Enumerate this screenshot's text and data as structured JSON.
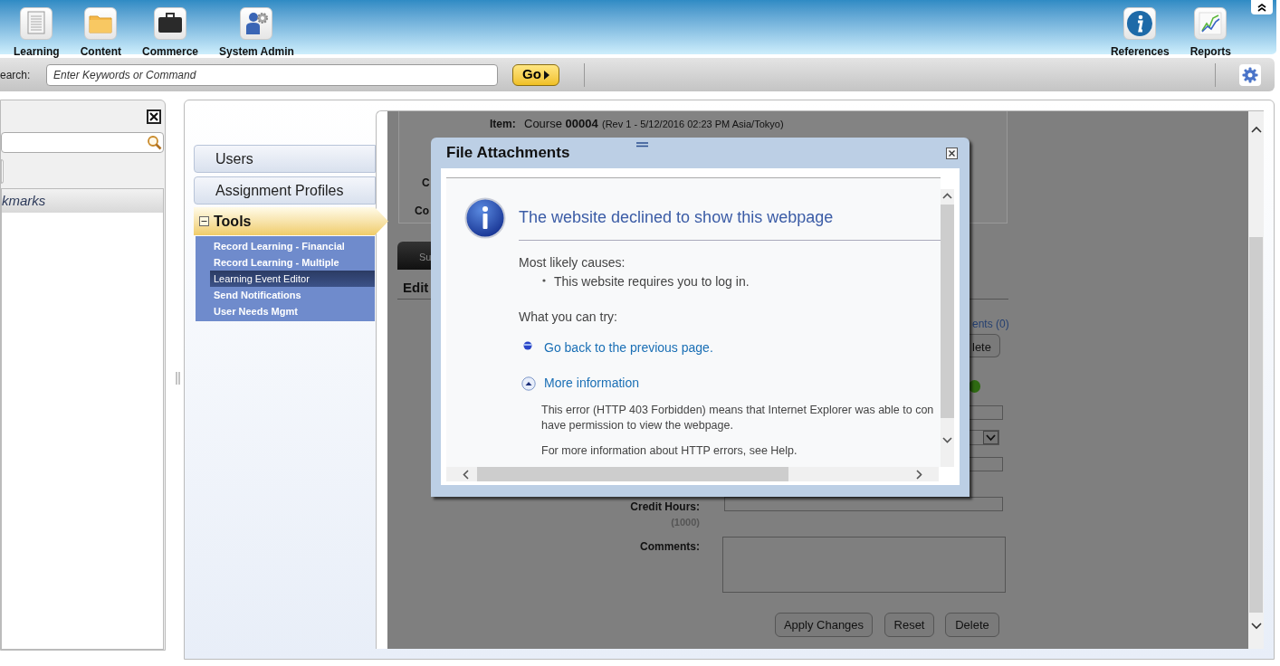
{
  "top_nav": {
    "left_items": [
      {
        "label": "Learning"
      },
      {
        "label": "Content"
      },
      {
        "label": "Commerce"
      },
      {
        "label": "System Admin"
      }
    ],
    "right_items": [
      {
        "label": "References"
      },
      {
        "label": "Reports"
      }
    ]
  },
  "search_bar": {
    "label": "earch:",
    "placeholder": "Enter Keywords or Command",
    "go_button": "Go"
  },
  "left_panel": {
    "bookmarks_header": "kmarks"
  },
  "nav": {
    "items": [
      {
        "label": "Users",
        "selected": false,
        "expanded": false
      },
      {
        "label": "Assignment Profiles",
        "selected": false,
        "expanded": false
      },
      {
        "label": "Tools",
        "selected": true,
        "expanded": true,
        "children": [
          {
            "label": "Record Learning - Financial",
            "selected": false
          },
          {
            "label": "Record Learning - Multiple",
            "selected": false
          },
          {
            "label": "Learning Event Editor",
            "selected": true
          },
          {
            "label": "Send Notifications",
            "selected": false
          },
          {
            "label": "User Needs Mgmt",
            "selected": false
          }
        ]
      }
    ]
  },
  "form": {
    "item_label": "Item:",
    "item_value": "Course **00004**",
    "item_revision": "(Rev 1 - 5/12/2016 02:23 PM Asia/Tokyo)",
    "partial_labels": [
      "C",
      "Co"
    ],
    "tab": "Su",
    "section_title": "Edit",
    "attachments_link": "ents (0)",
    "partial_button": "lete",
    "fields": [
      {
        "kind": "text",
        "label": "Credit Hours:",
        "hint": "(1000)"
      },
      {
        "kind": "textarea",
        "label": "Comments:"
      }
    ],
    "buttons": [
      "Apply Changes",
      "Reset",
      "Delete"
    ]
  },
  "dialog": {
    "title": "File Attachments",
    "heading": "The website declined to show this webpage",
    "causes_label": "Most likely causes:",
    "causes": [
      "This website requires you to log in."
    ],
    "try_label": "What you can try:",
    "actions": [
      {
        "kind": "bullet",
        "label": "Go back to the previous page."
      },
      {
        "kind": "expander",
        "label": "More information",
        "expanded": true
      }
    ],
    "details": [
      "This error (HTTP 403 Forbidden) means that Internet Explorer was able to con",
      "have permission to view the webpage.",
      "For more information about HTTP errors, see Help."
    ]
  }
}
